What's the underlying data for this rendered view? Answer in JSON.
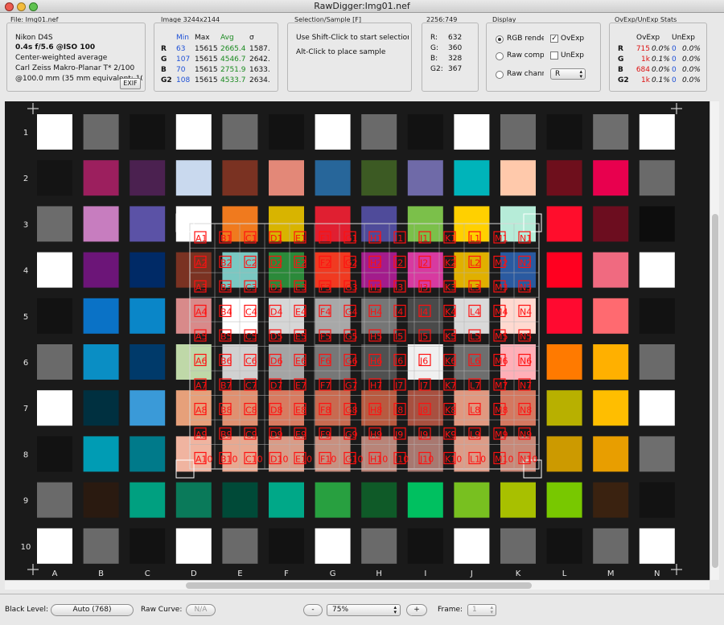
{
  "window": {
    "title": "RawDigger:Img01.nef"
  },
  "file_panel": {
    "header": "File: Img01.nef",
    "camera": "Nikon D4S",
    "exposure": "0.4s f/5.6 @ISO 100",
    "metering": "Center-weighted average",
    "lens": "Carl Zeiss Makro-Planar T* 2/100",
    "focal": "@100.0 mm (35 mm equivalent: 100 mm)",
    "exif_button": "EXIF"
  },
  "image_panel": {
    "header": "Image 3244x2144",
    "col_min": "Min",
    "col_max": "Max",
    "col_avg": "Avg",
    "col_sigma": "σ",
    "rows": [
      {
        "ch": "R",
        "min": "63",
        "max": "15615",
        "avg": "2665.4",
        "sigma": "1587."
      },
      {
        "ch": "G",
        "min": "107",
        "max": "15615",
        "avg": "4546.7",
        "sigma": "2642."
      },
      {
        "ch": "B",
        "min": "70",
        "max": "15615",
        "avg": "2751.9",
        "sigma": "1633."
      },
      {
        "ch": "G2",
        "min": "108",
        "max": "15615",
        "avg": "4533.7",
        "sigma": "2634."
      }
    ]
  },
  "selection_panel": {
    "header": "Selection/Sample [F]",
    "line1": "Use Shift-Click to start selection",
    "line2": "Alt-Click to place sample"
  },
  "coord_panel": {
    "header": "2256:749",
    "rows": [
      {
        "ch": "R:",
        "val": "632"
      },
      {
        "ch": "G:",
        "val": "360"
      },
      {
        "ch": "B:",
        "val": "328"
      },
      {
        "ch": "G2:",
        "val": "367"
      }
    ]
  },
  "display_panel": {
    "header": "Display",
    "opt_rgb": "RGB render",
    "opt_raw_comp": "Raw composite",
    "opt_raw_chan": "Raw channel",
    "chk_ovexp": "OvExp",
    "chk_unexp": "UnExp",
    "channel_select": "R"
  },
  "stats_panel": {
    "header": "OvExp/UnExp Stats",
    "col_ov": "OvExp",
    "col_un": "UnExp",
    "rows": [
      {
        "ch": "R",
        "ov_n": "715",
        "ov_p": "0.0%",
        "un_n": "0",
        "un_p": "0.0%"
      },
      {
        "ch": "G",
        "ov_n": "1k",
        "ov_p": "0.1%",
        "un_n": "0",
        "un_p": "0.0%"
      },
      {
        "ch": "B",
        "ov_n": "684",
        "ov_p": "0.0%",
        "un_n": "0",
        "un_p": "0.0%"
      },
      {
        "ch": "G2",
        "ov_n": "1k",
        "ov_p": "0.1%",
        "un_n": "0",
        "un_p": "0.0%"
      }
    ]
  },
  "chart": {
    "row_labels": [
      "1",
      "2",
      "3",
      "4",
      "5",
      "6",
      "7",
      "8",
      "9",
      "10"
    ],
    "col_labels": [
      "A",
      "B",
      "C",
      "D",
      "E",
      "F",
      "G",
      "H",
      "I",
      "J",
      "K",
      "L",
      "M",
      "N"
    ],
    "patches": [
      [
        "#ffffff",
        "#6a6a6a",
        "#121212",
        "#ffffff",
        "#6a6a6a",
        "#121212",
        "#ffffff",
        "#6a6a6a",
        "#121212",
        "#ffffff",
        "#6a6a6a",
        "#121212",
        "#6e6e6e",
        "#ffffff"
      ],
      [
        "#141414",
        "#9c1f5e",
        "#4b2150",
        "#c9d9ee",
        "#7a3222",
        "#e38878",
        "#27669a",
        "#3c5a23",
        "#6f6aa8",
        "#00b4ba",
        "#ffc9ab",
        "#6e0f1c",
        "#e8004e",
        "#6a6a6a"
      ],
      [
        "#6c6c6c",
        "#c77dbf",
        "#5b52a6",
        "#ffffff",
        "#f07a1e",
        "#d8b400",
        "#e01f31",
        "#4f4b9a",
        "#7bc04a",
        "#ffd000",
        "#b6ecd8",
        "#ff0d2c",
        "#6c0d1f",
        "#0d0d0d"
      ],
      [
        "#ffffff",
        "#6c1578",
        "#002a66",
        "#7a3222",
        "#7ac8c2",
        "#2b8a3a",
        "#f03a21",
        "#a31c8c",
        "#d73aa0",
        "#e0b000",
        "#2a5aa0",
        "#ff0020",
        "#f06a80",
        "#ffffff"
      ],
      [
        "#121212",
        "#0a72c6",
        "#0a86c8",
        "#d88a8a",
        "#ffffff",
        "#d6d6d6",
        "#a8a8a8",
        "#767676",
        "#4a4a4a",
        "#d9d9d9",
        "#ffd9d0",
        "#ff0a30",
        "#ff6a70",
        "#121212"
      ],
      [
        "#6a6a6a",
        "#0a8ec4",
        "#003a6a",
        "#bfd8a8",
        "#d1d1d1",
        "#a4a4a4",
        "#777777",
        "#505050",
        "#f0f0f0",
        "#6e6e6e",
        "#ffb0b8",
        "#ff7a00",
        "#ffb000",
        "#6a6a6a"
      ],
      [
        "#ffffff",
        "#003040",
        "#3a9ad8",
        "#e6a07a",
        "#e09070",
        "#d87a60",
        "#c86a50",
        "#b85a40",
        "#a85040",
        "#e09880",
        "#d47860",
        "#b8b000",
        "#ffbe00",
        "#ffffff"
      ],
      [
        "#121212",
        "#009cb4",
        "#007a8a",
        "#f0b4a0",
        "#e8a890",
        "#d89c88",
        "#c89080",
        "#b88478",
        "#a87870",
        "#dc9c88",
        "#c88878",
        "#cc9a00",
        "#e89e00",
        "#6e6e6e"
      ],
      [
        "#6a6a6a",
        "#2a1a10",
        "#00a080",
        "#0a7a5a",
        "#004a38",
        "#00a888",
        "#28a040",
        "#0f5a28",
        "#00c060",
        "#78c020",
        "#a8c000",
        "#78c800",
        "#3a2210",
        "#121212"
      ],
      [
        "#ffffff",
        "#6a6a6a",
        "#121212",
        "#ffffff",
        "#6a6a6a",
        "#121212",
        "#ffffff",
        "#6a6a6a",
        "#121212",
        "#ffffff",
        "#6a6a6a",
        "#121212",
        "#6a6a6a",
        "#ffffff"
      ]
    ],
    "sample_rows": [
      "1",
      "2",
      "3",
      "4",
      "5",
      "6",
      "7",
      "8",
      "9",
      "10"
    ],
    "sample_cols": [
      "A",
      "B",
      "C",
      "D",
      "E",
      "F",
      "G",
      "H",
      "I",
      "J",
      "K",
      "L",
      "M",
      "N"
    ]
  },
  "bottom": {
    "black_label": "Black Level:",
    "black_value": "Auto (768)",
    "curve_label": "Raw Curve:",
    "curve_value": "N/A",
    "zoom_minus": "-",
    "zoom_value": "75%",
    "zoom_plus": "+",
    "frame_label": "Frame:",
    "frame_value": "1"
  }
}
